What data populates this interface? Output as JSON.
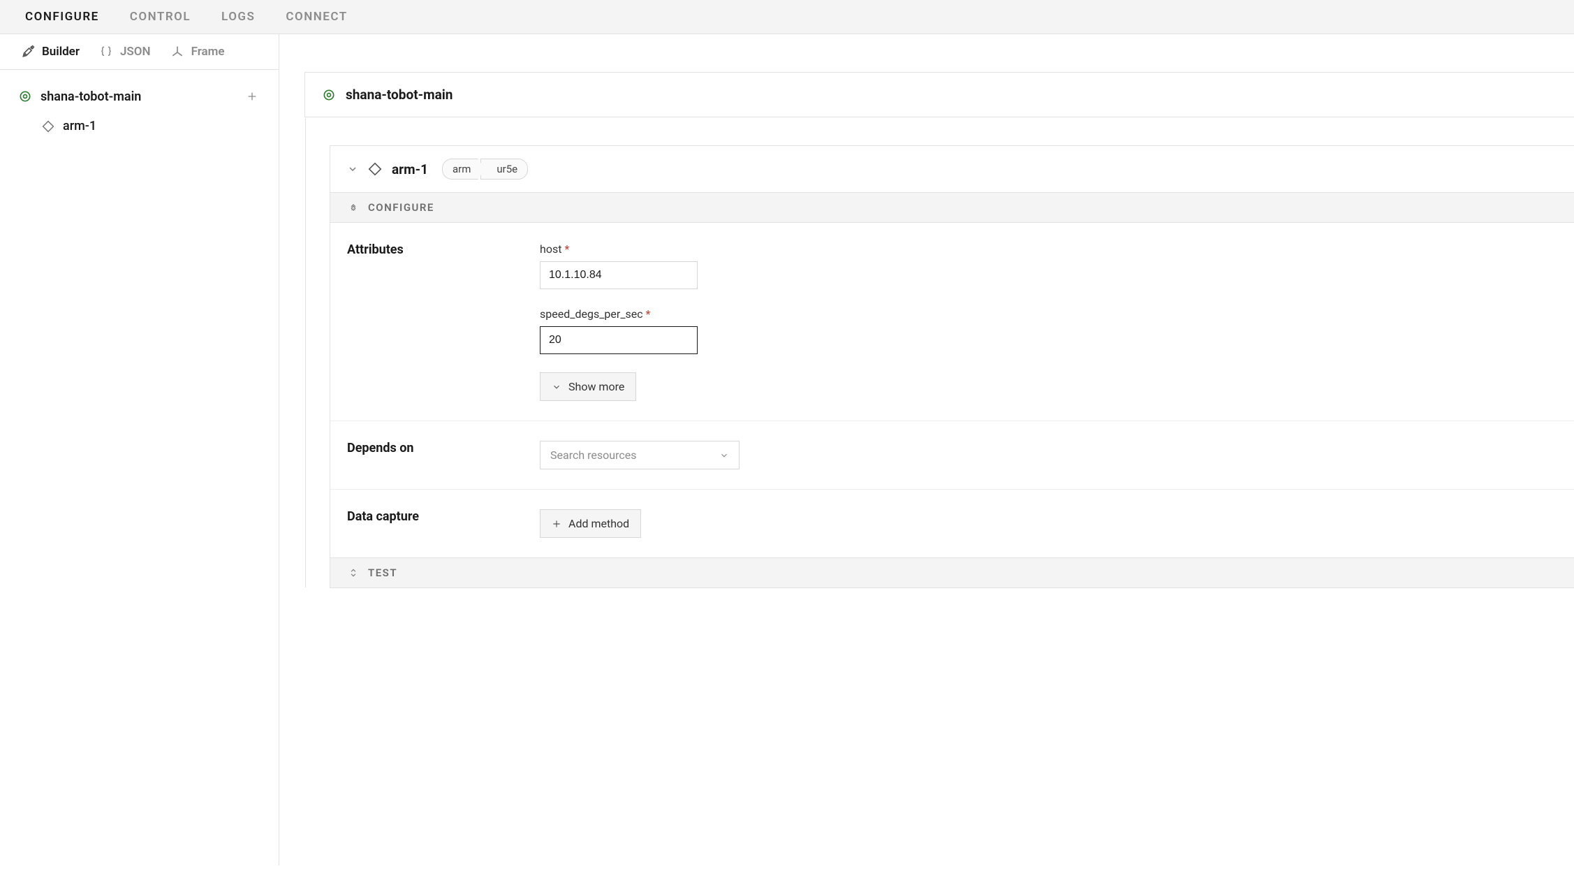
{
  "topTabs": {
    "configure": "CONFIGURE",
    "control": "CONTROL",
    "logs": "LOGS",
    "connect": "CONNECT"
  },
  "subTabs": {
    "builder": "Builder",
    "json": "JSON",
    "frame": "Frame"
  },
  "tree": {
    "root": "shana-tobot-main",
    "child": "arm-1"
  },
  "machineHeader": "shana-tobot-main",
  "component": {
    "name": "arm-1",
    "typeChip": "arm",
    "modelChip": "ur5e"
  },
  "sections": {
    "configure": "CONFIGURE",
    "test": "TEST"
  },
  "form": {
    "attributesLabel": "Attributes",
    "dependsOnLabel": "Depends on",
    "dataCaptureLabel": "Data capture",
    "hostLabel": "host",
    "hostValue": "10.1.10.84",
    "speedLabel": "speed_degs_per_sec",
    "speedValue": "20",
    "showMore": "Show more",
    "searchResourcesPlaceholder": "Search resources",
    "addMethod": "Add method"
  }
}
